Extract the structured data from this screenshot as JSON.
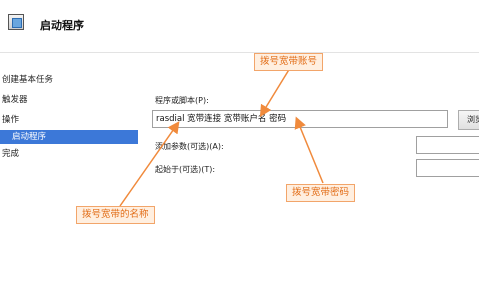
{
  "window": {
    "title": "启动程序"
  },
  "nav": {
    "items": [
      {
        "label": "创建基本任务"
      },
      {
        "label": "触发器"
      },
      {
        "label": "操作"
      },
      {
        "label": "启动程序"
      },
      {
        "label": "完成"
      }
    ]
  },
  "form": {
    "program_label": "程序或脚本(P):",
    "program_value": "rasdial 宽带连接 宽带账户名 密码",
    "browse_label": "浏览",
    "args_label": "添加参数(可选)(A):",
    "args_value": "",
    "start_label": "起始于(可选)(T):",
    "start_value": ""
  },
  "callouts": {
    "account": "拨号宽带账号",
    "password": "拨号宽带密码",
    "name": "拨号宽带的名称"
  },
  "colors": {
    "selection": "#3c78d8",
    "callout_text": "#e26d17",
    "callout_border": "#f2a56a",
    "callout_fill": "#ffefe0",
    "arrow": "#f08a3c"
  }
}
